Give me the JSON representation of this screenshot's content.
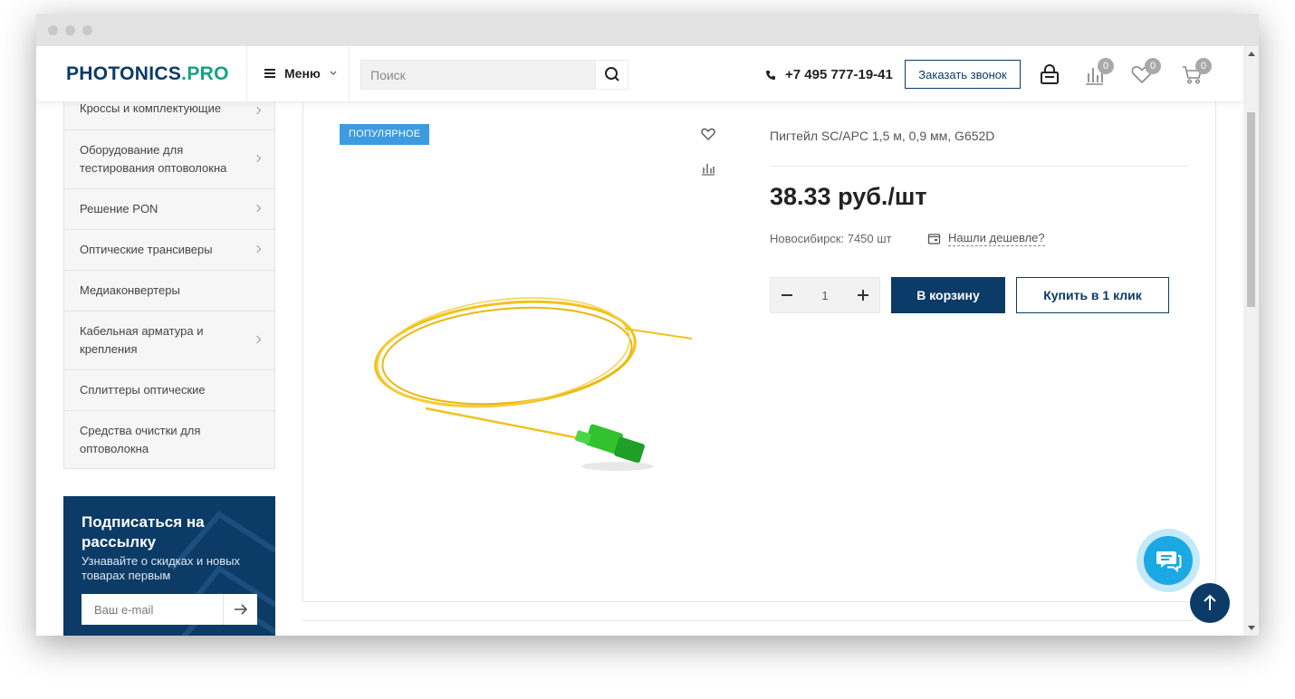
{
  "header": {
    "logo_main": "PHOTONICS",
    "logo_dot": ".",
    "logo_suffix": "PRO",
    "menu_label": "Меню",
    "search_placeholder": "Поиск",
    "phone": "+7 495 777-19-41",
    "callback_label": "Заказать звонок",
    "compare_count": "0",
    "favorites_count": "0",
    "cart_count": "0"
  },
  "sidebar": {
    "categories": [
      {
        "label": "Кроссы и комплектующие",
        "has_sub": true
      },
      {
        "label": "Оборудование для тестирования оптоволокна",
        "has_sub": true
      },
      {
        "label": "Решение PON",
        "has_sub": true
      },
      {
        "label": "Оптические трансиверы",
        "has_sub": true
      },
      {
        "label": "Медиаконвертеры",
        "has_sub": false
      },
      {
        "label": "Кабельная арматура и крепления",
        "has_sub": true
      },
      {
        "label": "Сплиттеры оптические",
        "has_sub": false
      },
      {
        "label": "Средства очистки для оптоволокна",
        "has_sub": false
      }
    ]
  },
  "subscribe": {
    "title": "Подписаться на рассылку",
    "subtitle": "Узнавайте о скидках и новых товарах первым",
    "email_placeholder": "Ваш e-mail"
  },
  "product": {
    "badge": "ПОПУЛЯРНОЕ",
    "name": "Пигтейл SC/APC 1,5 м, 0,9 мм, G652D",
    "price": "38.33 руб./шт",
    "stock": "Новосибирск: 7450 шт",
    "cheaper_label": "Нашли дешевле?",
    "quantity": "1",
    "add_to_cart_label": "В корзину",
    "buy_one_click_label": "Купить в 1 клик"
  },
  "colors": {
    "brand_dark": "#0b3b66",
    "brand_green": "#14a37f",
    "badge_blue": "#3d9be0",
    "chat_blue": "#1ca8e3"
  }
}
